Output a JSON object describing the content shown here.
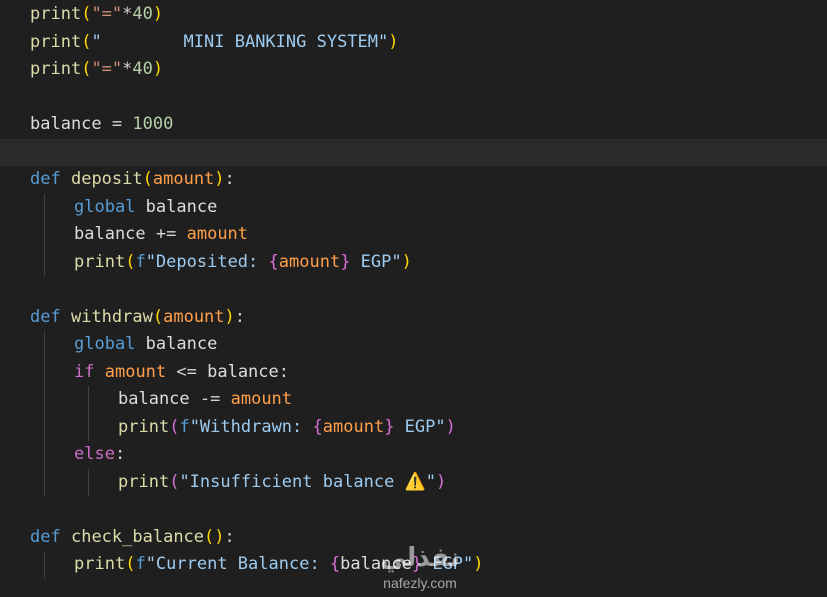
{
  "editor": {
    "colors": {
      "background": "#1f1f1f",
      "function": "#dcdcaa",
      "keyword_control": "#cc6ec5",
      "keyword_storage": "#569cd6",
      "string": "#ce9178",
      "number": "#b5cea8",
      "variable": "#9cdcfe",
      "parameter": "#ff9f4a",
      "bracket": "#ffd700"
    },
    "lines": [
      {
        "tokens": [
          [
            "fn",
            "print"
          ],
          [
            "par",
            "("
          ],
          [
            "str",
            "\"=\""
          ],
          [
            "op",
            "*"
          ],
          [
            "num",
            "40"
          ],
          [
            "par",
            ")"
          ]
        ]
      },
      {
        "tokens": [
          [
            "fn",
            "print"
          ],
          [
            "par",
            "("
          ],
          [
            "strp",
            "\"        MINI BANKING SYSTEM\""
          ],
          [
            "par",
            ")"
          ]
        ]
      },
      {
        "tokens": [
          [
            "fn",
            "print"
          ],
          [
            "par",
            "("
          ],
          [
            "str",
            "\"=\""
          ],
          [
            "op",
            "*"
          ],
          [
            "num",
            "40"
          ],
          [
            "par",
            ")"
          ]
        ]
      },
      {
        "tokens": []
      },
      {
        "tokens": [
          [
            "var2",
            "balance"
          ],
          [
            "op",
            " = "
          ],
          [
            "num",
            "1000"
          ]
        ]
      },
      {
        "tokens": [],
        "current": true
      },
      {
        "tokens": [
          [
            "kwb",
            "def"
          ],
          [
            "op",
            " "
          ],
          [
            "fn",
            "deposit"
          ],
          [
            "par",
            "("
          ],
          [
            "prm",
            "amount"
          ],
          [
            "par",
            ")"
          ],
          [
            "op",
            ":"
          ]
        ]
      },
      {
        "indent": 1,
        "tokens": [
          [
            "kwb",
            "global"
          ],
          [
            "op",
            " "
          ],
          [
            "var2",
            "balance"
          ]
        ]
      },
      {
        "indent": 1,
        "tokens": [
          [
            "var2",
            "balance"
          ],
          [
            "op",
            " += "
          ],
          [
            "prm",
            "amount"
          ]
        ]
      },
      {
        "indent": 1,
        "tokens": [
          [
            "fn",
            "print"
          ],
          [
            "par",
            "("
          ],
          [
            "fpre",
            "f"
          ],
          [
            "strp",
            "\"Deposited: "
          ],
          [
            "brc",
            "{"
          ],
          [
            "prm",
            "amount"
          ],
          [
            "brc",
            "}"
          ],
          [
            "strp",
            " EGP\""
          ],
          [
            "par",
            ")"
          ]
        ]
      },
      {
        "tokens": []
      },
      {
        "tokens": [
          [
            "kwb",
            "def"
          ],
          [
            "op",
            " "
          ],
          [
            "fn",
            "withdraw"
          ],
          [
            "par",
            "("
          ],
          [
            "prm",
            "amount"
          ],
          [
            "par",
            ")"
          ],
          [
            "op",
            ":"
          ]
        ]
      },
      {
        "indent": 1,
        "tokens": [
          [
            "kwb",
            "global"
          ],
          [
            "op",
            " "
          ],
          [
            "var2",
            "balance"
          ]
        ]
      },
      {
        "indent": 1,
        "tokens": [
          [
            "kw",
            "if"
          ],
          [
            "op",
            " "
          ],
          [
            "prm",
            "amount"
          ],
          [
            "op",
            " <= "
          ],
          [
            "var2",
            "balance"
          ],
          [
            "op",
            ":"
          ]
        ]
      },
      {
        "indent": 2,
        "tokens": [
          [
            "var2",
            "balance"
          ],
          [
            "op",
            " -= "
          ],
          [
            "prm",
            "amount"
          ]
        ]
      },
      {
        "indent": 2,
        "tokens": [
          [
            "fn",
            "print"
          ],
          [
            "par2",
            "("
          ],
          [
            "fpre",
            "f"
          ],
          [
            "strp",
            "\"Withdrawn: "
          ],
          [
            "brc",
            "{"
          ],
          [
            "prm",
            "amount"
          ],
          [
            "brc",
            "}"
          ],
          [
            "strp",
            " EGP\""
          ],
          [
            "par2",
            ")"
          ]
        ]
      },
      {
        "indent": 1,
        "tokens": [
          [
            "kw",
            "else"
          ],
          [
            "op",
            ":"
          ]
        ]
      },
      {
        "indent": 2,
        "tokens": [
          [
            "fn",
            "print"
          ],
          [
            "par2",
            "("
          ],
          [
            "strp",
            "\"Insufficient balance "
          ],
          [
            "warn",
            "⚠️"
          ],
          [
            "strp",
            "\""
          ],
          [
            "par2",
            ")"
          ]
        ]
      },
      {
        "tokens": []
      },
      {
        "tokens": [
          [
            "kwb",
            "def"
          ],
          [
            "op",
            " "
          ],
          [
            "fn",
            "check_balance"
          ],
          [
            "par",
            "()"
          ],
          [
            "op",
            ":"
          ]
        ]
      },
      {
        "indent": 1,
        "tokens": [
          [
            "fn",
            "print"
          ],
          [
            "par",
            "("
          ],
          [
            "fpre",
            "f"
          ],
          [
            "strp",
            "\"Current Balance: "
          ],
          [
            "brc",
            "{"
          ],
          [
            "var2",
            "balance"
          ],
          [
            "brc",
            "}"
          ],
          [
            "strp",
            " EGP\""
          ],
          [
            "par",
            ")"
          ]
        ]
      }
    ]
  },
  "watermark": {
    "logo": "نفذلي",
    "url": "nafezly.com"
  }
}
